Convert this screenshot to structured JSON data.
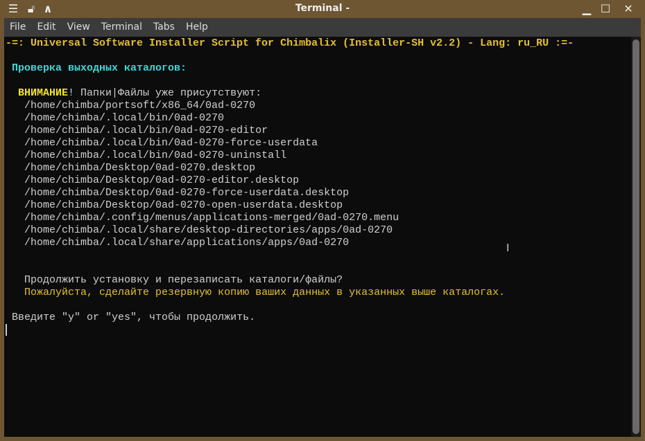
{
  "window": {
    "title": "Terminal -"
  },
  "menu": [
    "File",
    "Edit",
    "View",
    "Terminal",
    "Tabs",
    "Help"
  ],
  "terminal": {
    "header": "-=: Universal Software Installer Script for Chimbalix (Installer-SH v2.2) - Lang: ru_RU :=-",
    "section": "Проверка выходных каталогов:",
    "warning_word": "ВНИМАНИЕ",
    "warning_rest": "! Папки|Файлы уже присутствуют:",
    "paths": [
      "/home/chimba/portsoft/x86_64/0ad-0270",
      "/home/chimba/.local/bin/0ad-0270",
      "/home/chimba/.local/bin/0ad-0270-editor",
      "/home/chimba/.local/bin/0ad-0270-force-userdata",
      "/home/chimba/.local/bin/0ad-0270-uninstall",
      "/home/chimba/Desktop/0ad-0270.desktop",
      "/home/chimba/Desktop/0ad-0270-editor.desktop",
      "/home/chimba/Desktop/0ad-0270-force-userdata.desktop",
      "/home/chimba/Desktop/0ad-0270-open-userdata.desktop",
      "/home/chimba/.config/menus/applications-merged/0ad-0270.menu",
      "/home/chimba/.local/share/desktop-directories/apps/0ad-0270",
      "/home/chimba/.local/share/applications/apps/0ad-0270"
    ],
    "question": "Продолжить установку и перезаписать каталоги/файлы?",
    "backup_note": "Пожалуйста, сделайте резервную копию ваших данных в указанных выше каталогах.",
    "prompt": "Введите \"y\" or \"yes\", чтобы продолжить."
  }
}
